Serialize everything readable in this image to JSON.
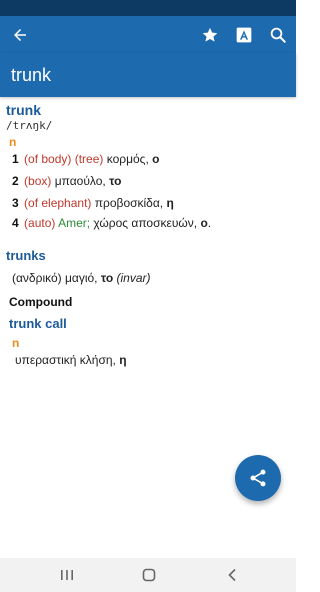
{
  "title": "trunk",
  "entry": {
    "headword": "trunk",
    "pronunciation": "/trʌŋk/",
    "pos": "n",
    "senses": [
      {
        "num": "1",
        "labels": "(of body) (tree)",
        "register": "",
        "translation": " κορμός, ",
        "gender": "ο",
        "note": ""
      },
      {
        "num": "2",
        "labels": "(box)",
        "register": "",
        "translation": " μπαούλο, ",
        "gender": "το",
        "note": ""
      },
      {
        "num": "3",
        "labels": "(of elephant)",
        "register": "",
        "translation": " προβοσκίδα, ",
        "gender": "η",
        "note": ""
      },
      {
        "num": "4",
        "labels": "(auto)",
        "register": " Amer;",
        "translation": " χώρος αποσκευών, ",
        "gender": "ο",
        "note": "."
      }
    ]
  },
  "plural": {
    "headword": "trunks",
    "translation": "(ανδρικό) μαγιό, ",
    "gender": "το",
    "note": " (invar)"
  },
  "compound": {
    "heading": "Compound",
    "headword": "trunk call",
    "pos": "n",
    "translation": "υπεραστική κλήση, ",
    "gender": "η"
  },
  "icons": {
    "back": "arrow-left-icon",
    "favorite": "star-icon",
    "font": "font-size-icon",
    "search": "search-icon",
    "share": "share-icon",
    "recents": "recent-apps-icon",
    "home": "home-icon",
    "navback": "nav-back-icon"
  },
  "colors": {
    "primary": "#1d6aaf",
    "status_bar": "#0c3a63",
    "headword": "#1d5a99",
    "pos": "#ef8a1c",
    "label": "#c0392b",
    "register": "#2e8b3a"
  }
}
